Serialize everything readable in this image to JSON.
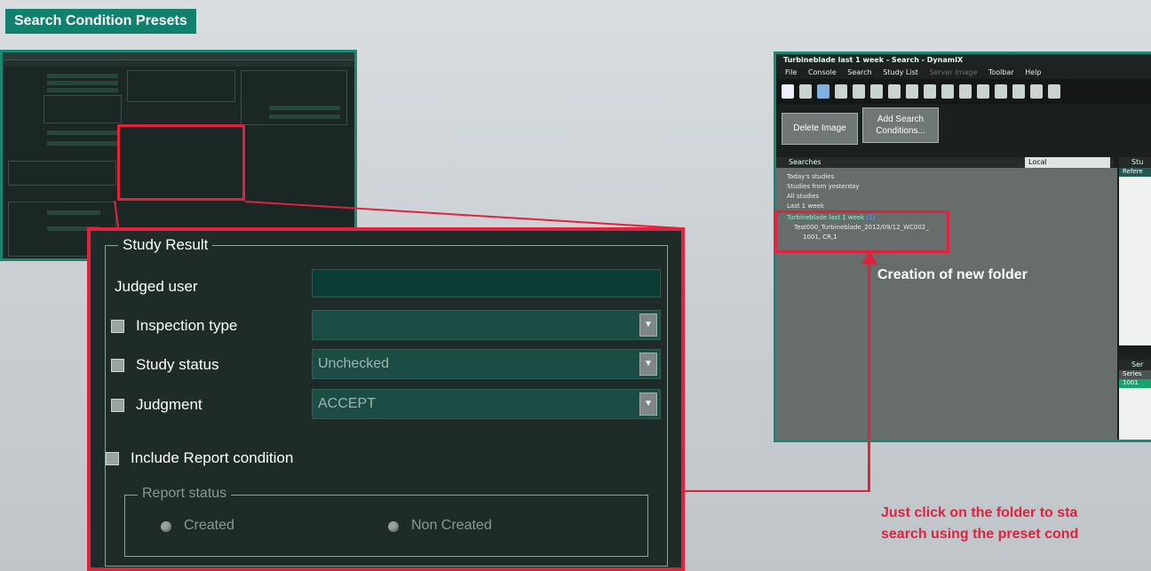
{
  "header": {
    "title": "Search Condition Presets"
  },
  "zoom_panel": {
    "group_title": "Study Result",
    "judged_user_label": "Judged user",
    "judged_user_value": "",
    "inspection_type_label": "Inspection type",
    "inspection_type_value": "",
    "study_status_label": "Study status",
    "study_status_value": "Unchecked",
    "judgment_label": "Judgment",
    "judgment_value": "ACCEPT",
    "include_report_label": "Include Report condition",
    "report_status_title": "Report status",
    "created_label": "Created",
    "non_created_label": "Non Created"
  },
  "app_window": {
    "title": "Turbineblade last 1 week - Search - DynamIX",
    "menu": [
      "File",
      "Console",
      "Search",
      "Study List",
      "Server Image",
      "Toolbar",
      "Help"
    ],
    "delete_button": "Delete Image",
    "add_search_button_line1": "Add Search",
    "add_search_button_line2": "Conditions...",
    "searches_header": "Searches",
    "location_value": "Local",
    "tree": [
      "Today's studies",
      "Studies from yesterday",
      "All studies",
      "Last 1 week",
      "Turbineblade last 1 week",
      "Test000_Turbineblade_2012/09/12_WC002_",
      "1001, CR,1"
    ],
    "tree_count": "(1)",
    "right_pane_header": "Stu",
    "right_pane_col": "Refere",
    "series_header": "Ser",
    "series_col": "Series",
    "series_row": "1001"
  },
  "annotations": {
    "new_folder": "Creation of new folder",
    "note_line1": "Just click on the folder to sta",
    "note_line2": "search using the preset cond"
  },
  "colors": {
    "accent_green": "#11806c",
    "callout_red": "#e1223d",
    "panel_bg": "#1f2b29"
  }
}
